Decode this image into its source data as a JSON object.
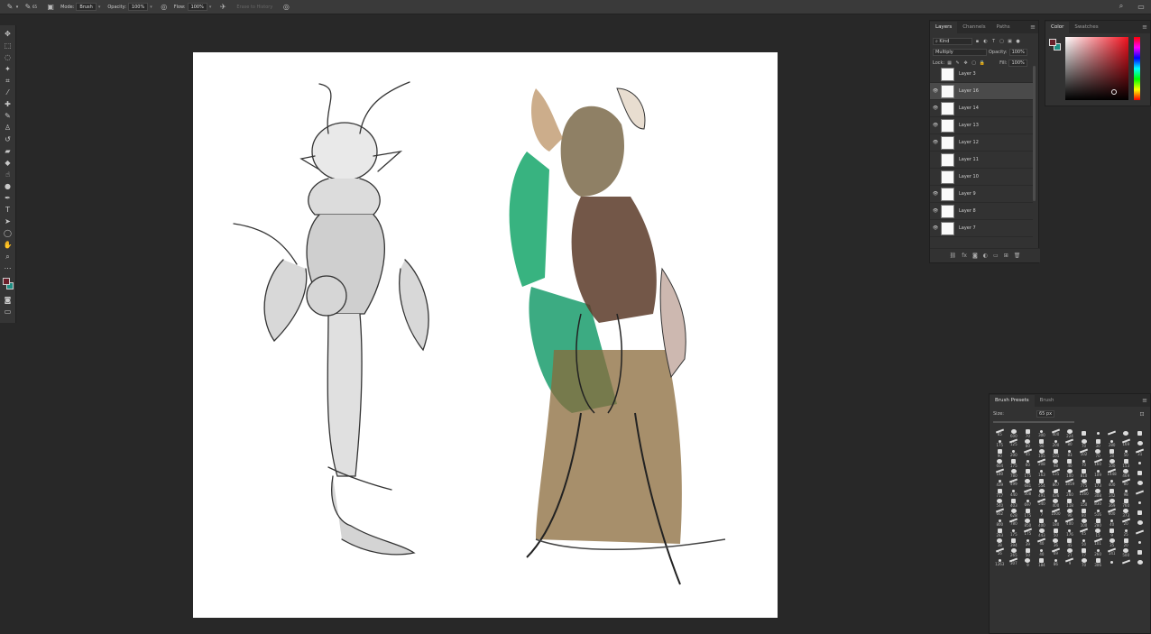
{
  "options_bar": {
    "mode_label": "Mode:",
    "mode_value": "Brush",
    "opacity_label": "Opacity:",
    "opacity_value": "100%",
    "flow_label": "Flow:",
    "flow_value": "100%",
    "brush_size": "65",
    "erase_history_label": "Erase to History"
  },
  "toolbar": {
    "tools": [
      "move-icon",
      "marquee-icon",
      "lasso-icon",
      "magic-wand-icon",
      "crop-icon",
      "eyedropper-icon",
      "healing-brush-icon",
      "brush-icon",
      "clone-stamp-icon",
      "history-brush-icon",
      "eraser-icon",
      "paint-bucket-icon",
      "smudge-icon",
      "dodge-icon",
      "pen-icon",
      "type-icon",
      "path-selection-icon",
      "ellipse-shape-icon",
      "hand-icon",
      "zoom-icon",
      "more-tools-icon"
    ],
    "colors": {
      "foreground": "#6b1f2a",
      "background": "#1e8e83"
    }
  },
  "layers_panel": {
    "tabs": [
      "Layers",
      "Channels",
      "Paths"
    ],
    "filter_kind": "Kind",
    "blend_mode": "Multiply",
    "opacity_label": "Opacity:",
    "opacity_value": "100%",
    "lock_label": "Lock:",
    "fill_label": "Fill:",
    "fill_value": "100%",
    "layers": [
      {
        "name": "Layer 3",
        "visible": false,
        "selected": false
      },
      {
        "name": "Layer 16",
        "visible": true,
        "selected": true
      },
      {
        "name": "Layer 14",
        "visible": true,
        "selected": false
      },
      {
        "name": "Layer 13",
        "visible": true,
        "selected": false
      },
      {
        "name": "Layer 12",
        "visible": true,
        "selected": false
      },
      {
        "name": "Layer 11",
        "visible": false,
        "selected": false
      },
      {
        "name": "Layer 10",
        "visible": false,
        "selected": false
      },
      {
        "name": "Layer 9",
        "visible": true,
        "selected": false
      },
      {
        "name": "Layer 8",
        "visible": true,
        "selected": false
      },
      {
        "name": "Layer 7",
        "visible": true,
        "selected": false
      }
    ]
  },
  "color_panel": {
    "tabs": [
      "Color",
      "Swatches"
    ],
    "foreground": "#6b1f2a",
    "background": "#1e8e83"
  },
  "brush_presets": {
    "tabs": [
      "Brush Presets",
      "Brush"
    ],
    "size_label": "Size:",
    "size_value": "65 px",
    "sizes": [
      "65",
      "600",
      "70",
      "300",
      "400",
      "224",
      "",
      "",
      "",
      "",
      "",
      "175",
      "125",
      "80",
      "90",
      "200",
      "80",
      "70",
      "30",
      "280",
      "169",
      "",
      "90",
      "200",
      "45",
      "105",
      "101",
      "83",
      "102",
      "70",
      "30",
      "50",
      "31",
      "604",
      "175",
      "60",
      "208",
      "98",
      "40",
      "70",
      "160",
      "100",
      "153",
      "",
      "180",
      "780",
      "175",
      "163",
      "135",
      "100",
      "810",
      "109",
      "1448",
      "469",
      "",
      "439",
      "499",
      "681",
      "554",
      "867",
      "1859",
      "775",
      "173",
      "400",
      "80",
      "",
      "717",
      "440",
      "308",
      "491",
      "436",
      "260",
      "1160",
      "308",
      "142",
      "98",
      "",
      "540",
      "403",
      "697",
      "540",
      "400",
      "118",
      "150",
      "830",
      "369",
      "760",
      "",
      "662",
      "628",
      "175",
      "7",
      "1000",
      "90",
      "80",
      "516",
      "600",
      "373",
      "",
      "800",
      "780",
      "850",
      "400",
      "180",
      "400",
      "100",
      "280",
      "40",
      "20",
      "",
      "283",
      "175",
      "175",
      "443",
      "50",
      "176",
      "45",
      "15",
      "9",
      "25",
      "",
      "38",
      "394",
      "39",
      "40",
      "36",
      "45",
      "50",
      "101",
      "35",
      "20",
      "",
      "56",
      "265",
      "50",
      "40",
      "69",
      "27",
      "77",
      "260",
      "141",
      "500",
      "",
      "1263",
      "307",
      "9",
      "184",
      "86",
      "9",
      "70",
      "306",
      "",
      "",
      ""
    ]
  }
}
